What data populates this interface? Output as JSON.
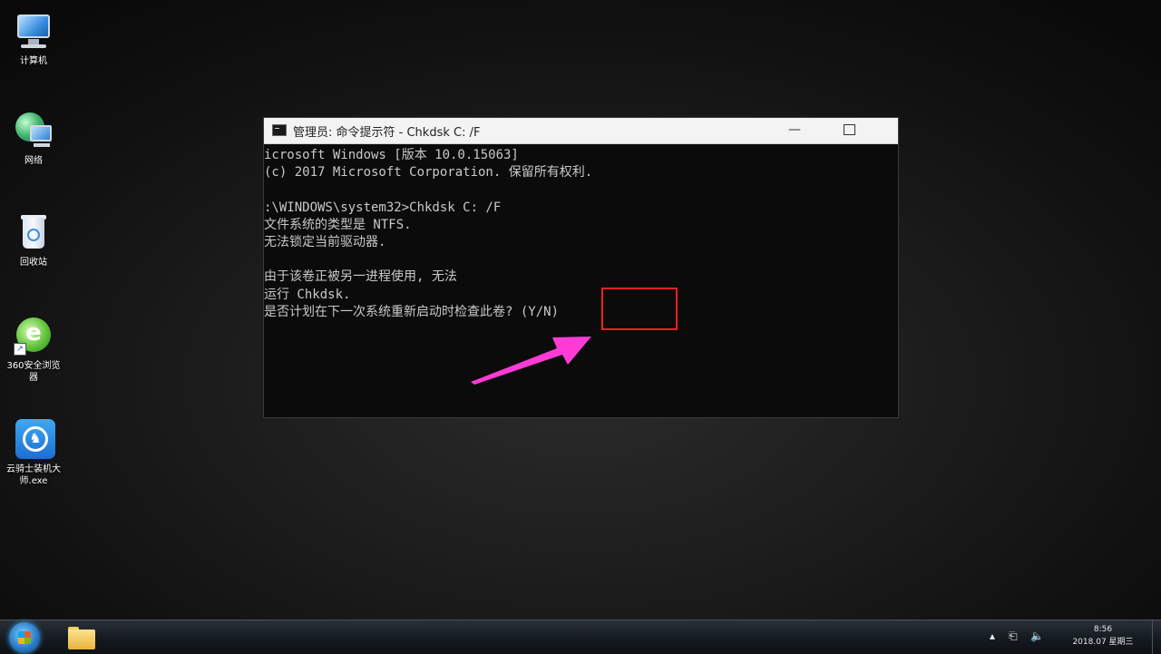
{
  "desktop": {
    "icons": [
      {
        "label": "计算机",
        "icon": "computer-icon"
      },
      {
        "label": "网络",
        "icon": "network-icon"
      },
      {
        "label": "回收站",
        "icon": "recycle-bin-icon"
      },
      {
        "label": "360安全浏览器",
        "icon": "browser-360-icon"
      },
      {
        "label": "云骑士装机大师.exe",
        "icon": "cloud-knight-icon"
      }
    ]
  },
  "cmd": {
    "title": "管理员: 命令提示符 - Chkdsk  C: /F",
    "minimize_symbol": "—",
    "lines": [
      "icrosoft Windows [版本 10.0.15063]",
      "(c) 2017 Microsoft Corporation. 保留所有权利.",
      "",
      ":\\WINDOWS\\system32>Chkdsk C: /F",
      "文件系统的类型是 NTFS.",
      "无法锁定当前驱动器.",
      "",
      "由于该卷正被另一进程使用, 无法",
      "运行 Chkdsk.",
      "是否计划在下一次系统重新启动时检查此卷? (Y/N)"
    ]
  },
  "annotation": {
    "highlight_color": "#ff1f1f",
    "arrow_color": "#ff3bd6"
  },
  "taskbar": {
    "clock_time": "8:56",
    "clock_date": "2018.07 星期三",
    "tray_icons": [
      "arrow-up-icon",
      "network-status-icon",
      "volume-icon"
    ]
  }
}
